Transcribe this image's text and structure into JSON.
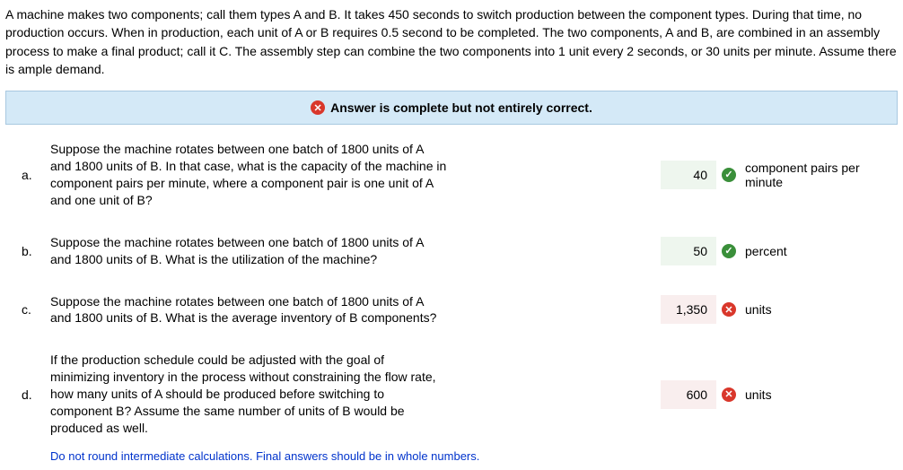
{
  "intro": "A machine makes two components; call them types A and B. It takes 450 seconds to switch production between the component types. During that time, no production occurs. When in production, each unit of A or B requires 0.5 second to be completed. The two components, A and B, are combined in an assembly process to make a final product; call it C. The assembly step can combine the two components into 1 unit every 2 seconds, or 30 units per minute. Assume there is ample demand.",
  "banner": {
    "text": "Answer is complete but not entirely correct.",
    "icon": "✕"
  },
  "questions": [
    {
      "label": "a.",
      "text": "Suppose the machine rotates between one batch of 1800 units of A and 1800 units of B. In that case, what is the capacity of the machine in component pairs per minute, where a component pair is one unit of A and one unit of B?",
      "answer": "40",
      "correct": true,
      "unit": "component pairs per minute"
    },
    {
      "label": "b.",
      "text": "Suppose the machine rotates between one batch of 1800 units of A and 1800 units of B. What is the utilization of the machine?",
      "answer": "50",
      "correct": true,
      "unit": "percent"
    },
    {
      "label": "c.",
      "text": "Suppose the machine rotates between one batch of 1800 units of A and 1800 units of B. What is the average inventory of B components?",
      "answer": "1,350",
      "correct": false,
      "unit": "units"
    },
    {
      "label": "d.",
      "text": "If the production schedule could be adjusted with the goal of minimizing inventory in the process without constraining the flow rate, how many units of A should be produced before switching to component B? Assume the same number of units of B would be produced as well.",
      "answer": "600",
      "correct": false,
      "unit": "units"
    }
  ],
  "note": "Do not round intermediate calculations. Final answers should be in whole numbers."
}
